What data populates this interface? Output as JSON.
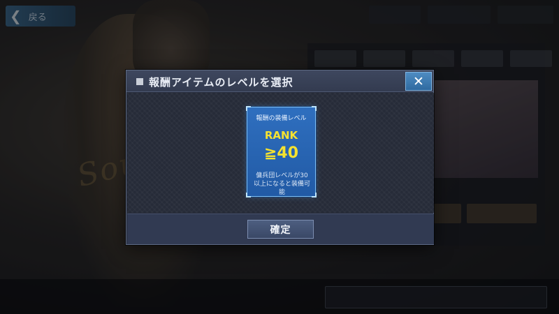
{
  "background": {
    "back_label": "戻る"
  },
  "dialog": {
    "title": "報酬アイテムのレベルを選択",
    "close_symbol": "✕",
    "card": {
      "title": "報酬の装備レベル",
      "rank_label": "RANK",
      "level": "≧40",
      "description": "傭兵団レベルが30以上になると装備可能"
    },
    "confirm_label": "確定"
  },
  "colors": {
    "accent_blue": "#2f6fbf",
    "rank_yellow": "#f5e230",
    "close_blue": "#3f7db3"
  }
}
